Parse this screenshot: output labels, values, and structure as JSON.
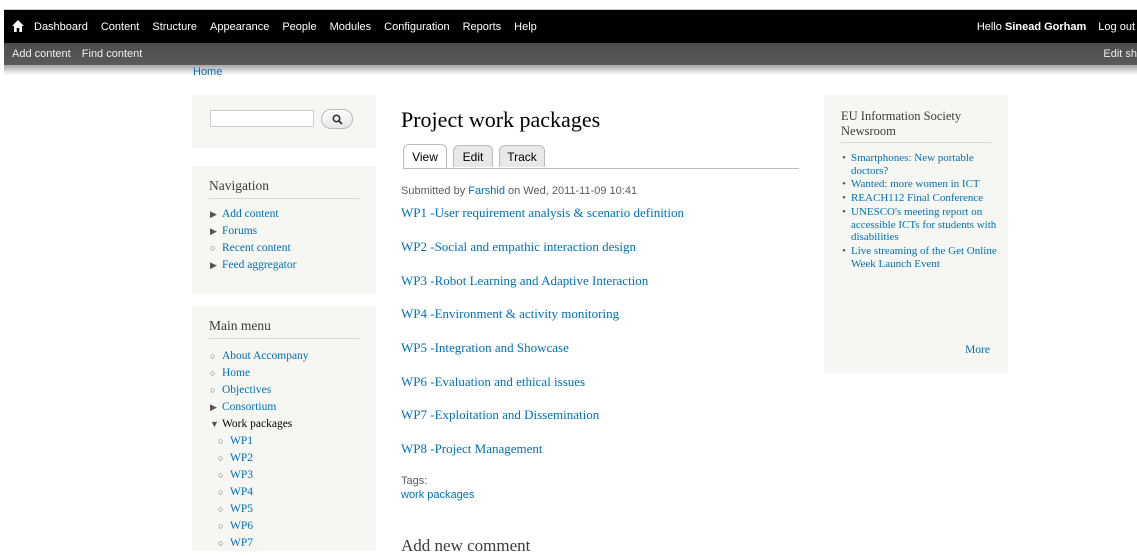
{
  "toolbar": {
    "items": [
      "Dashboard",
      "Content",
      "Structure",
      "Appearance",
      "People",
      "Modules",
      "Configuration",
      "Reports",
      "Help"
    ],
    "greeting": "Hello",
    "user_name": "Sinead Gorham",
    "logout": "Log out"
  },
  "shortcuts": {
    "items": [
      "Add content",
      "Find content"
    ],
    "edit": "Edit sh"
  },
  "breadcrumb": "Home",
  "search": {
    "value": ""
  },
  "navigation": {
    "title": "Navigation",
    "items": [
      {
        "label": "Add content",
        "bullet": "collapsed"
      },
      {
        "label": "Forums",
        "bullet": "collapsed"
      },
      {
        "label": "Recent content",
        "bullet": "leaf"
      },
      {
        "label": "Feed aggregator",
        "bullet": "collapsed"
      }
    ]
  },
  "main_menu": {
    "title": "Main menu",
    "items": [
      {
        "label": "About Accompany",
        "bullet": "leaf"
      },
      {
        "label": "Home",
        "bullet": "leaf"
      },
      {
        "label": "Objectives",
        "bullet": "leaf"
      },
      {
        "label": "Consortium",
        "bullet": "collapsed"
      },
      {
        "label": "Work packages",
        "bullet": "expanded"
      }
    ],
    "sub_items": [
      "WP1",
      "WP2",
      "WP3",
      "WP4",
      "WP5",
      "WP6",
      "WP7"
    ]
  },
  "node": {
    "title": "Project work packages",
    "tabs": [
      "View",
      "Edit",
      "Track"
    ],
    "submitted_prefix": "Submitted by",
    "author": "Farshid",
    "submitted_date": "on Wed, 2011-11-09 10:41",
    "links": [
      "WP1 -User requirement analysis & scenario definition",
      "WP2 -Social and empathic interaction design",
      "WP3 -Robot Learning and Adaptive Interaction",
      "WP4 -Environment & activity monitoring",
      "WP5 -Integration and Showcase",
      "WP6 -Evaluation and ethical issues",
      "WP7 -Exploitation and Dissemination",
      "WP8 -Project Management"
    ],
    "tags_label": "Tags:",
    "tags_value": "work packages",
    "comment_title": "Add new comment"
  },
  "news": {
    "title_line1": "EU Information Society",
    "title_line2": "Newsroom",
    "items": [
      "Smartphones: New portable doctors?",
      "Wanted: more women in ICT",
      "REACH112 Final Conference",
      "UNESCO's meeting report on accessible ICTs for students with disabilities",
      "Live streaming of the Get Online Week Launch Event"
    ],
    "more": "More"
  },
  "colors": {
    "link": "#0071b3",
    "toolbar": "#000000",
    "block_bg": "#f6f6f2"
  },
  "icons": {
    "home": "home-icon",
    "search": "search-icon"
  }
}
